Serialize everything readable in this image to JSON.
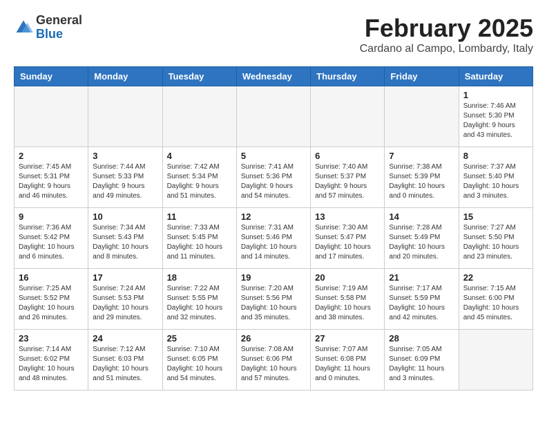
{
  "header": {
    "logo_general": "General",
    "logo_blue": "Blue",
    "month_title": "February 2025",
    "location": "Cardano al Campo, Lombardy, Italy"
  },
  "weekdays": [
    "Sunday",
    "Monday",
    "Tuesday",
    "Wednesday",
    "Thursday",
    "Friday",
    "Saturday"
  ],
  "weeks": [
    [
      {
        "day": "",
        "info": ""
      },
      {
        "day": "",
        "info": ""
      },
      {
        "day": "",
        "info": ""
      },
      {
        "day": "",
        "info": ""
      },
      {
        "day": "",
        "info": ""
      },
      {
        "day": "",
        "info": ""
      },
      {
        "day": "1",
        "info": "Sunrise: 7:46 AM\nSunset: 5:30 PM\nDaylight: 9 hours and 43 minutes."
      }
    ],
    [
      {
        "day": "2",
        "info": "Sunrise: 7:45 AM\nSunset: 5:31 PM\nDaylight: 9 hours and 46 minutes."
      },
      {
        "day": "3",
        "info": "Sunrise: 7:44 AM\nSunset: 5:33 PM\nDaylight: 9 hours and 49 minutes."
      },
      {
        "day": "4",
        "info": "Sunrise: 7:42 AM\nSunset: 5:34 PM\nDaylight: 9 hours and 51 minutes."
      },
      {
        "day": "5",
        "info": "Sunrise: 7:41 AM\nSunset: 5:36 PM\nDaylight: 9 hours and 54 minutes."
      },
      {
        "day": "6",
        "info": "Sunrise: 7:40 AM\nSunset: 5:37 PM\nDaylight: 9 hours and 57 minutes."
      },
      {
        "day": "7",
        "info": "Sunrise: 7:38 AM\nSunset: 5:39 PM\nDaylight: 10 hours and 0 minutes."
      },
      {
        "day": "8",
        "info": "Sunrise: 7:37 AM\nSunset: 5:40 PM\nDaylight: 10 hours and 3 minutes."
      }
    ],
    [
      {
        "day": "9",
        "info": "Sunrise: 7:36 AM\nSunset: 5:42 PM\nDaylight: 10 hours and 6 minutes."
      },
      {
        "day": "10",
        "info": "Sunrise: 7:34 AM\nSunset: 5:43 PM\nDaylight: 10 hours and 8 minutes."
      },
      {
        "day": "11",
        "info": "Sunrise: 7:33 AM\nSunset: 5:45 PM\nDaylight: 10 hours and 11 minutes."
      },
      {
        "day": "12",
        "info": "Sunrise: 7:31 AM\nSunset: 5:46 PM\nDaylight: 10 hours and 14 minutes."
      },
      {
        "day": "13",
        "info": "Sunrise: 7:30 AM\nSunset: 5:47 PM\nDaylight: 10 hours and 17 minutes."
      },
      {
        "day": "14",
        "info": "Sunrise: 7:28 AM\nSunset: 5:49 PM\nDaylight: 10 hours and 20 minutes."
      },
      {
        "day": "15",
        "info": "Sunrise: 7:27 AM\nSunset: 5:50 PM\nDaylight: 10 hours and 23 minutes."
      }
    ],
    [
      {
        "day": "16",
        "info": "Sunrise: 7:25 AM\nSunset: 5:52 PM\nDaylight: 10 hours and 26 minutes."
      },
      {
        "day": "17",
        "info": "Sunrise: 7:24 AM\nSunset: 5:53 PM\nDaylight: 10 hours and 29 minutes."
      },
      {
        "day": "18",
        "info": "Sunrise: 7:22 AM\nSunset: 5:55 PM\nDaylight: 10 hours and 32 minutes."
      },
      {
        "day": "19",
        "info": "Sunrise: 7:20 AM\nSunset: 5:56 PM\nDaylight: 10 hours and 35 minutes."
      },
      {
        "day": "20",
        "info": "Sunrise: 7:19 AM\nSunset: 5:58 PM\nDaylight: 10 hours and 38 minutes."
      },
      {
        "day": "21",
        "info": "Sunrise: 7:17 AM\nSunset: 5:59 PM\nDaylight: 10 hours and 42 minutes."
      },
      {
        "day": "22",
        "info": "Sunrise: 7:15 AM\nSunset: 6:00 PM\nDaylight: 10 hours and 45 minutes."
      }
    ],
    [
      {
        "day": "23",
        "info": "Sunrise: 7:14 AM\nSunset: 6:02 PM\nDaylight: 10 hours and 48 minutes."
      },
      {
        "day": "24",
        "info": "Sunrise: 7:12 AM\nSunset: 6:03 PM\nDaylight: 10 hours and 51 minutes."
      },
      {
        "day": "25",
        "info": "Sunrise: 7:10 AM\nSunset: 6:05 PM\nDaylight: 10 hours and 54 minutes."
      },
      {
        "day": "26",
        "info": "Sunrise: 7:08 AM\nSunset: 6:06 PM\nDaylight: 10 hours and 57 minutes."
      },
      {
        "day": "27",
        "info": "Sunrise: 7:07 AM\nSunset: 6:08 PM\nDaylight: 11 hours and 0 minutes."
      },
      {
        "day": "28",
        "info": "Sunrise: 7:05 AM\nSunset: 6:09 PM\nDaylight: 11 hours and 3 minutes."
      },
      {
        "day": "",
        "info": ""
      }
    ]
  ]
}
